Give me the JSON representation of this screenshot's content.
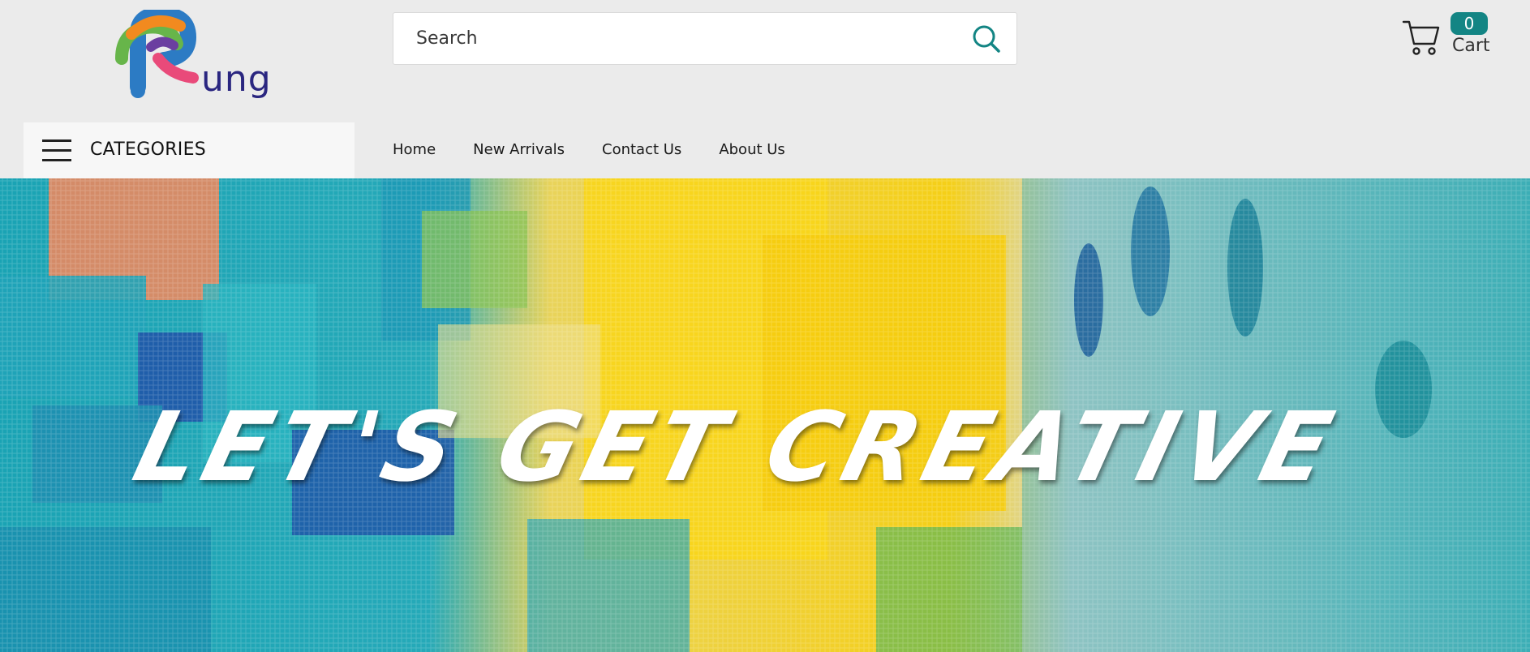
{
  "brand": {
    "logo_text": "ung",
    "logo_icon": "rung-r-logo",
    "text_color": "#2a2680"
  },
  "search": {
    "placeholder": "Search",
    "value": "",
    "icon": "search-icon",
    "icon_color": "#138584"
  },
  "cart": {
    "count": "0",
    "label": "Cart",
    "icon": "cart-icon",
    "badge_color": "#138584"
  },
  "categories": {
    "label": "CATEGORIES",
    "icon": "hamburger-icon"
  },
  "nav": {
    "items": [
      {
        "label": "Home"
      },
      {
        "label": "New Arrivals"
      },
      {
        "label": "Contact Us"
      },
      {
        "label": "About Us"
      }
    ]
  },
  "hero": {
    "title": "LET'S GET CREATIVE",
    "colors": {
      "teal": "#1aa3b4",
      "blue": "#1f57a8",
      "yellow": "#f5cf17",
      "orange": "#f4875a",
      "canvas": "#d9dcd6"
    }
  }
}
